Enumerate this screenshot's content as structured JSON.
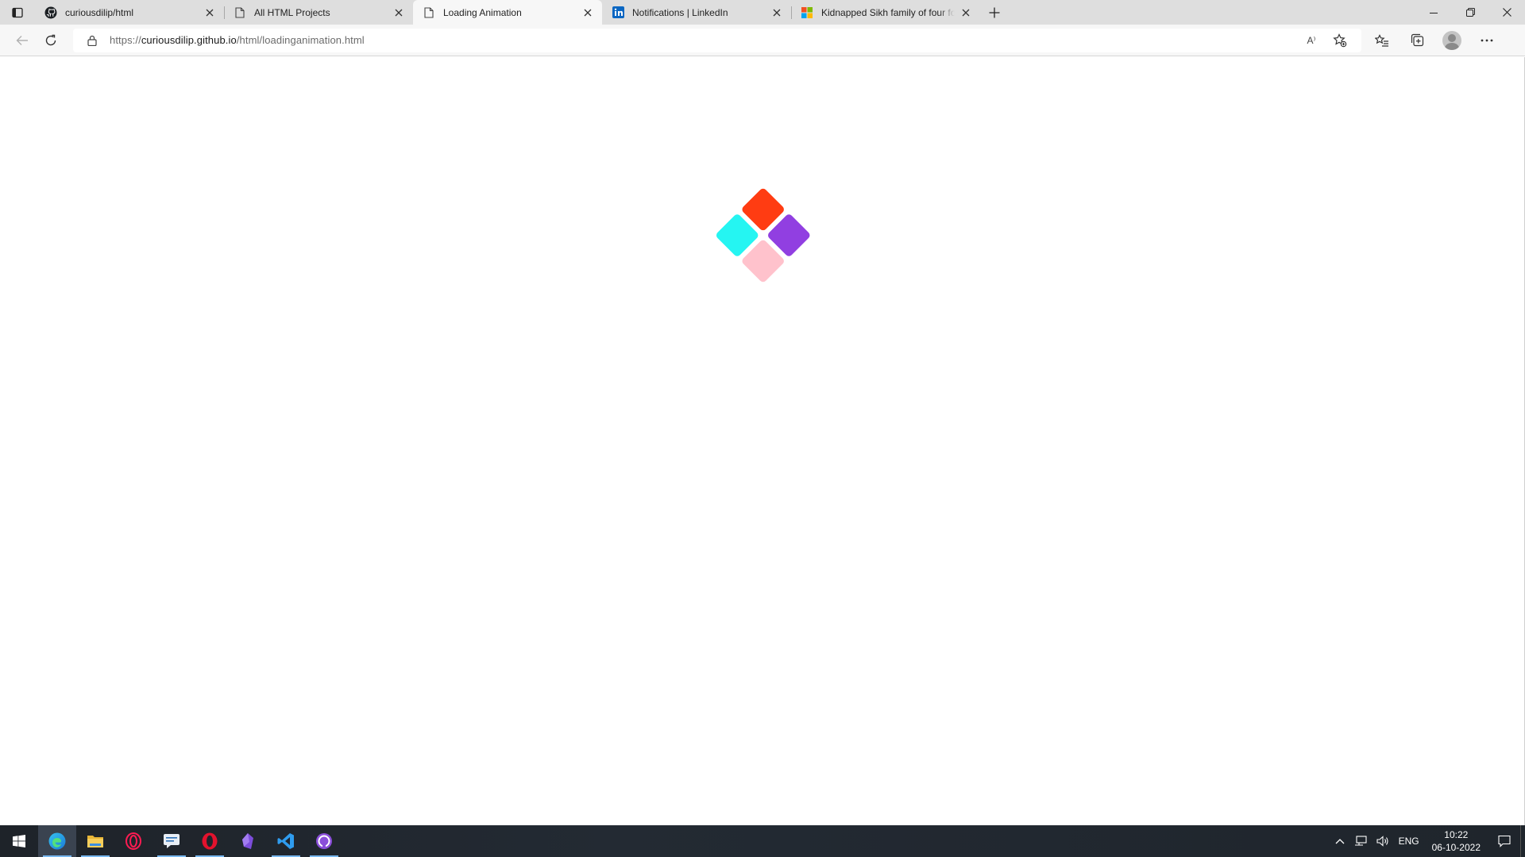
{
  "browser": {
    "tabs": [
      {
        "title": "curiousdilip/html",
        "icon": "github-icon",
        "active": false
      },
      {
        "title": "All HTML Projects",
        "icon": "page-icon",
        "active": false
      },
      {
        "title": "Loading Animation",
        "icon": "page-icon",
        "active": true
      },
      {
        "title": "Notifications | LinkedIn",
        "icon": "linkedin-icon",
        "active": false
      },
      {
        "title": "Kidnapped Sikh family of four fo",
        "icon": "microsoft-icon",
        "active": false
      }
    ],
    "address": {
      "scheme": "https://",
      "host": "curiousdilip.github.io",
      "path": "/html/loadinganimation.html"
    },
    "read_aloud_label": "A⁾"
  },
  "loader": {
    "colors": [
      "#ff3c12",
      "#913fe1",
      "#25f5f2",
      "#ffc2cc"
    ]
  },
  "taskbar": {
    "apps": [
      "windows-start-icon",
      "edge-icon",
      "file-explorer-icon",
      "opera-gx-icon",
      "messaging-icon",
      "opera-icon",
      "obsidian-icon",
      "vscode-icon",
      "github-desktop-icon"
    ],
    "language": "ENG",
    "time": "10:22",
    "date": "06-10-2022"
  }
}
